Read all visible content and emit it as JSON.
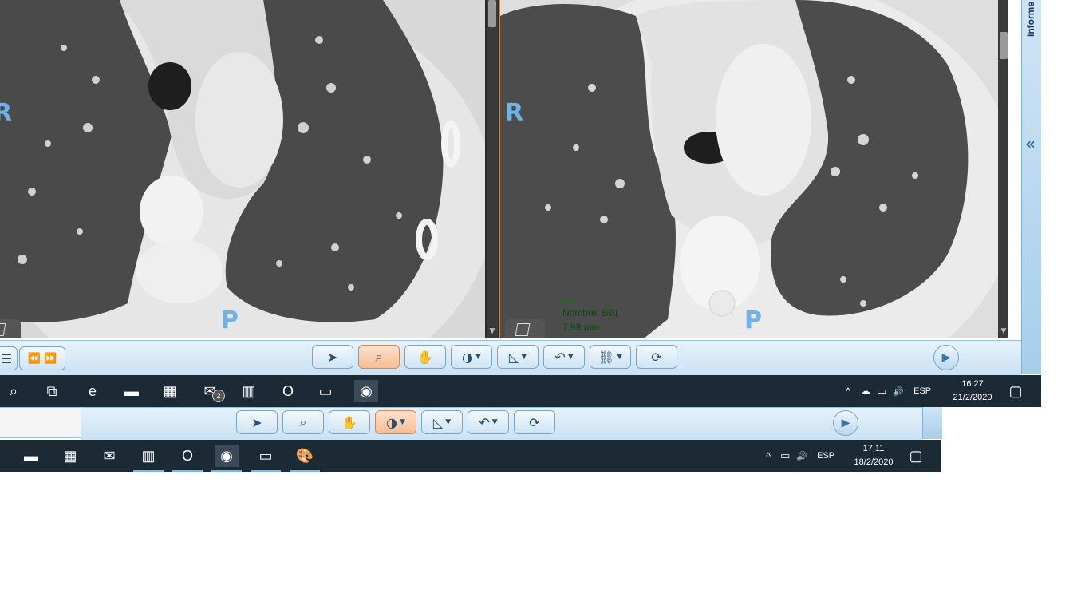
{
  "viewer": {
    "left_panel": {
      "orientation_right": "R",
      "orientation_posterior": "P"
    },
    "right_panel": {
      "orientation_right": "R",
      "orientation_posterior": "P",
      "annotation": {
        "name": "Nombre: B01",
        "measurement": "7.99 mm"
      }
    },
    "side_panel_label": "Informe",
    "collapse_glyph": "«"
  },
  "toolbar_main": {
    "tools": [
      {
        "id": "select",
        "icon": "pointer-icon",
        "glyph": "➤",
        "active": false,
        "dropdown": false
      },
      {
        "id": "zoom",
        "icon": "magnifier-icon",
        "glyph": "⌕",
        "active": true,
        "dropdown": false
      },
      {
        "id": "pan",
        "icon": "hand-icon",
        "glyph": "✋",
        "active": false,
        "dropdown": false
      },
      {
        "id": "window-level",
        "icon": "contrast-icon",
        "glyph": "◑",
        "active": false,
        "dropdown": true
      },
      {
        "id": "measure",
        "icon": "ruler-icon",
        "glyph": "◺",
        "active": false,
        "dropdown": true
      },
      {
        "id": "angle",
        "icon": "angle-icon",
        "glyph": "↶",
        "active": false,
        "dropdown": true
      },
      {
        "id": "annotate",
        "icon": "link-annotation-icon",
        "glyph": "⛓",
        "active": false,
        "dropdown": true
      },
      {
        "id": "reset",
        "icon": "refresh-icon",
        "glyph": "⟳",
        "active": false,
        "dropdown": false
      }
    ],
    "nav": {
      "prev_glyph": "⏪",
      "next_glyph": "⏩",
      "menu_glyph": "☰"
    },
    "play_glyph": "▶"
  },
  "toolbar_secondary": {
    "tools": [
      {
        "id": "select",
        "icon": "pointer-icon",
        "glyph": "➤",
        "active": false,
        "dropdown": false
      },
      {
        "id": "zoom",
        "icon": "magnifier-icon",
        "glyph": "⌕",
        "active": false,
        "dropdown": false
      },
      {
        "id": "pan",
        "icon": "hand-icon",
        "glyph": "✋",
        "active": false,
        "dropdown": false
      },
      {
        "id": "window-level",
        "icon": "contrast-icon",
        "glyph": "◑",
        "active": true,
        "dropdown": true
      },
      {
        "id": "measure",
        "icon": "ruler-icon",
        "glyph": "◺",
        "active": false,
        "dropdown": true
      },
      {
        "id": "angle",
        "icon": "angle-icon",
        "glyph": "↶",
        "active": false,
        "dropdown": true
      },
      {
        "id": "reset",
        "icon": "refresh-icon",
        "glyph": "⟳",
        "active": false,
        "dropdown": false
      }
    ],
    "play_glyph": "▶"
  },
  "taskbar_top": {
    "apps": [
      {
        "name": "search-icon",
        "glyph": "⌕"
      },
      {
        "name": "task-view-icon",
        "glyph": "⧉"
      },
      {
        "name": "edge-icon",
        "glyph": "e"
      },
      {
        "name": "file-explorer-icon",
        "glyph": "▬"
      },
      {
        "name": "store-icon",
        "glyph": "▦"
      },
      {
        "name": "mail-icon",
        "glyph": "✉",
        "badge": "2"
      },
      {
        "name": "app-icon",
        "glyph": "▥"
      },
      {
        "name": "outlook-icon",
        "glyph": "O"
      },
      {
        "name": "app-icon",
        "glyph": "▭"
      },
      {
        "name": "chrome-icon",
        "glyph": "◉"
      }
    ],
    "tray": {
      "caret": "^",
      "cloud": "☁",
      "network": "▭",
      "volume": "🔊",
      "language": "ESP"
    },
    "time": "16:27",
    "date": "21/2/2020",
    "notification_glyph": "▢"
  },
  "taskbar_bottom": {
    "apps": [
      {
        "name": "file-explorer-icon",
        "glyph": "▬"
      },
      {
        "name": "store-icon",
        "glyph": "▦"
      },
      {
        "name": "mail-icon",
        "glyph": "✉"
      },
      {
        "name": "app-icon",
        "glyph": "▥"
      },
      {
        "name": "outlook-icon",
        "glyph": "O"
      },
      {
        "name": "chrome-icon",
        "glyph": "◉"
      },
      {
        "name": "app-icon",
        "glyph": "▭"
      },
      {
        "name": "paint-icon",
        "glyph": "🎨"
      }
    ],
    "tray": {
      "caret": "^",
      "network": "▭",
      "volume": "🔊",
      "language": "ESP"
    },
    "time": "17:11",
    "date": "18/2/2020",
    "notification_glyph": "▢"
  },
  "colors": {
    "orientation_label": "#6fb2e8",
    "annotation_text": "#0a4a12",
    "toolbar_active": "#f6bd94",
    "taskbar": "#1c2a36"
  }
}
